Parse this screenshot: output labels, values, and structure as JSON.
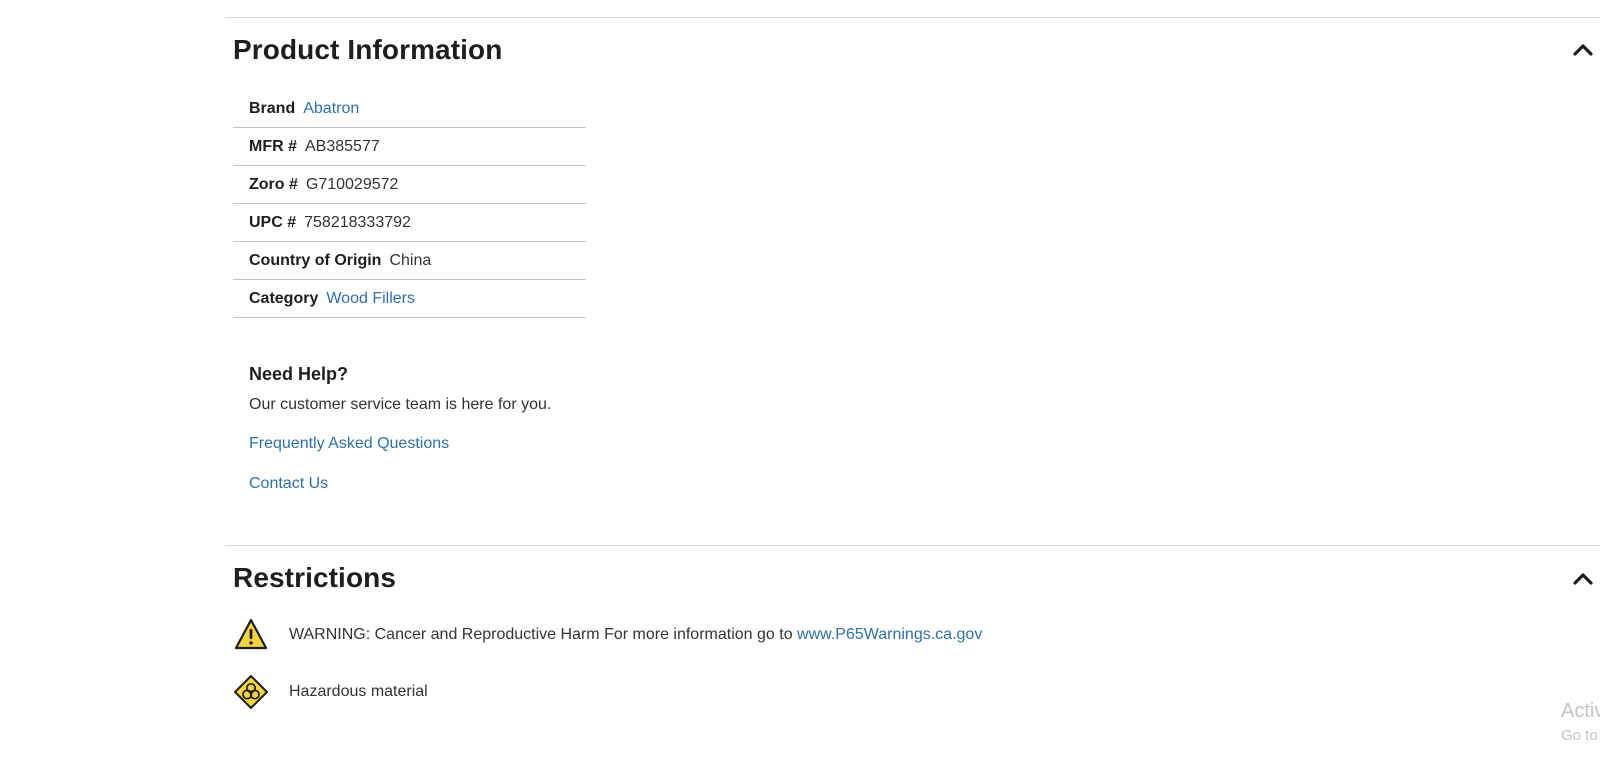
{
  "product_info": {
    "title": "Product Information",
    "toggle_icon": "chevron-up-icon",
    "specs": [
      {
        "label": "Brand",
        "value": "Abatron",
        "is_link": true
      },
      {
        "label": "MFR #",
        "value": "AB385577",
        "is_link": false
      },
      {
        "label": "Zoro #",
        "value": "G710029572",
        "is_link": false
      },
      {
        "label": "UPC #",
        "value": "758218333792",
        "is_link": false
      },
      {
        "label": "Country of Origin",
        "value": "China",
        "is_link": false
      },
      {
        "label": "Category",
        "value": "Wood Fillers",
        "is_link": true
      }
    ]
  },
  "help": {
    "title": "Need Help?",
    "text": "Our customer service team is here for you.",
    "faq_link": "Frequently Asked Questions",
    "contact_link": "Contact Us"
  },
  "restrictions": {
    "title": "Restrictions",
    "toggle_icon": "chevron-up-icon",
    "warning": {
      "icon": "warning-triangle-icon",
      "text": "WARNING: Cancer and Reproductive Harm For more information go to",
      "link": "www.P65Warnings.ca.gov"
    },
    "hazard": {
      "icon": "biohazard-icon",
      "text": "Hazardous material"
    }
  },
  "watermark": {
    "line1": "Activ",
    "line2": "Go to"
  },
  "colors": {
    "link": "#2f6fa8",
    "divider": "#d6d6d6",
    "warning_yellow": "#f5d43f"
  }
}
